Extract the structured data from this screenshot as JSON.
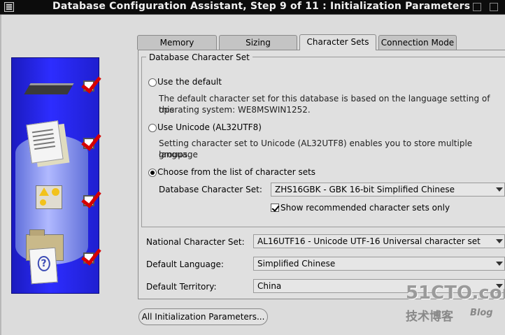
{
  "window": {
    "title": "Database Configuration Assistant, Step 9 of 11 : Initialization Parameters"
  },
  "tabs": [
    {
      "label": "Memory"
    },
    {
      "label": "Sizing"
    },
    {
      "label": "Character Sets"
    },
    {
      "label": "Connection Mode"
    }
  ],
  "charset_group": {
    "legend": "Database Character Set",
    "option_default": {
      "label": "Use the default",
      "description_line1": "The default character set for this database is based on the language setting of this",
      "description_line2": "operating system: WE8MSWIN1252."
    },
    "option_unicode": {
      "label": "Use Unicode (AL32UTF8)",
      "description_line1": "Setting character set to Unicode (AL32UTF8) enables you to store multiple language",
      "description_line2": "groups."
    },
    "option_list": {
      "label": "Choose from the list of character sets"
    },
    "db_charset_label": "Database Character Set:",
    "db_charset_value": "ZHS16GBK - GBK 16-bit Simplified Chinese",
    "show_recommended_label": "Show recommended character sets only"
  },
  "national": {
    "label": "National Character Set:",
    "value": "AL16UTF16 - Unicode UTF-16 Universal character set"
  },
  "language": {
    "label": "Default Language:",
    "value": "Simplified Chinese"
  },
  "territory": {
    "label": "Default Territory:",
    "value": "China"
  },
  "buttons": {
    "all_params": "All Initialization Parameters..."
  },
  "watermark": {
    "site": "51CTO.com",
    "chinese": "技术博客",
    "blog": "Blog"
  },
  "icons": {
    "window_menu": "window-menu-icon",
    "memory": "memory-chip-icon",
    "documents": "documents-icon",
    "shapes": "shapes-icon",
    "help": "help-document-icon",
    "check": "checkmark-icon"
  },
  "colors": {
    "art_blue": "#2d2dff",
    "check_red": "#d60000",
    "title_bg": "#0c0c0c"
  }
}
